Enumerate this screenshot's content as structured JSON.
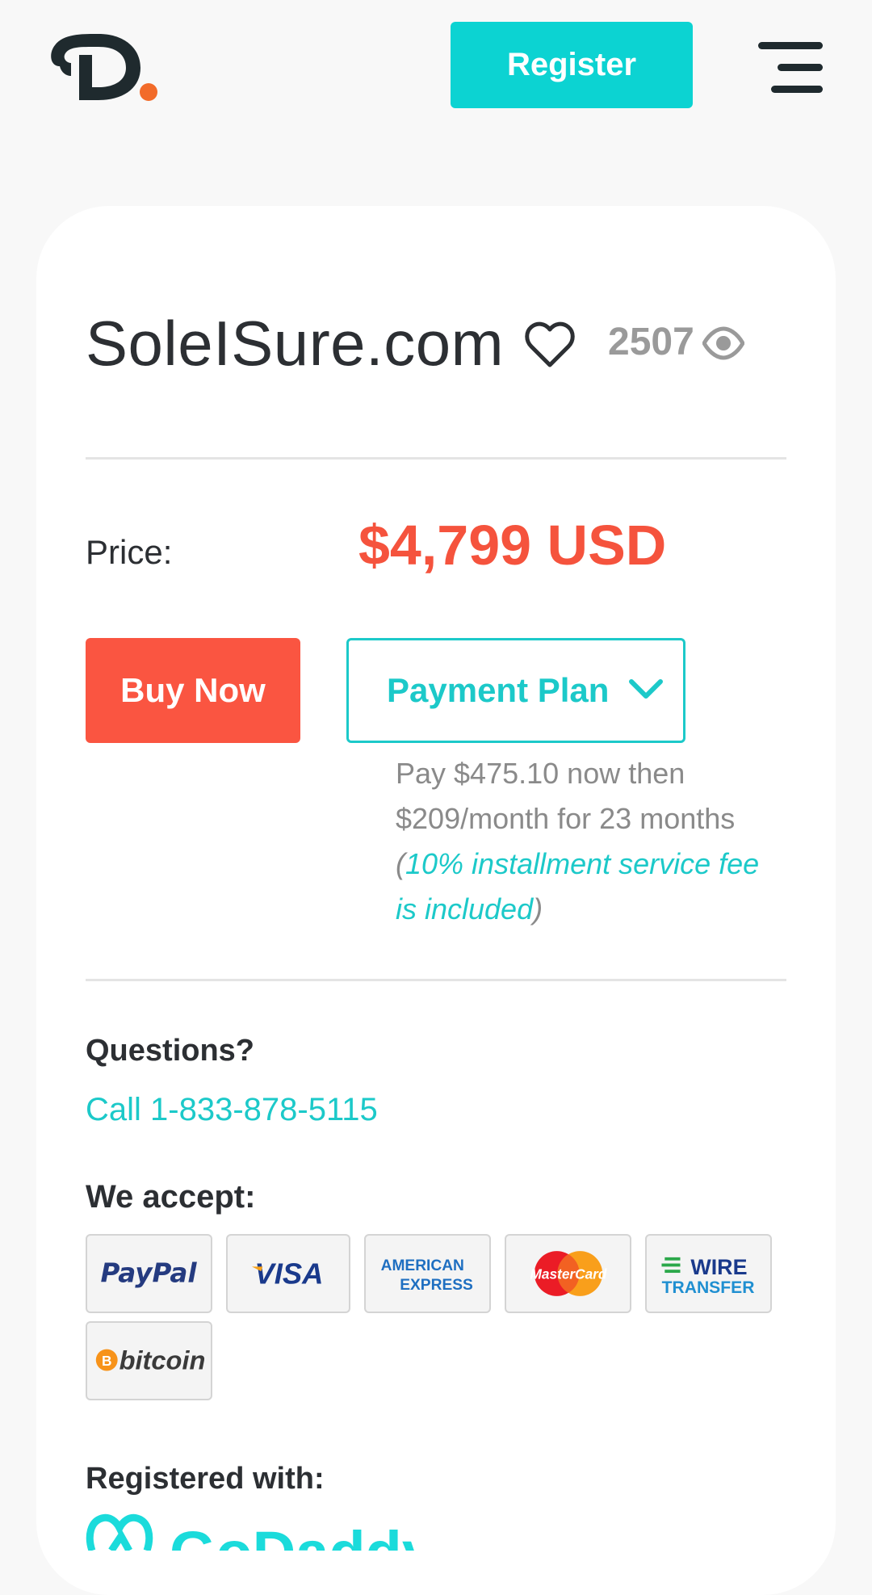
{
  "header": {
    "logo_letter": "D",
    "register_label": "Register",
    "menu_icon": "hamburger-menu-icon"
  },
  "listing": {
    "domain": "SoleISure.com",
    "favorite_icon": "heart-outline-icon",
    "views": "2507",
    "views_icon": "eye-icon"
  },
  "pricing": {
    "price_label": "Price:",
    "price_value": "$4,799 USD",
    "buy_label": "Buy Now",
    "plan_label": "Payment Plan",
    "plan_line1": "Pay $475.10 now then",
    "plan_line2": "$209/month for 23 months",
    "fee_open": "(",
    "fee_text": "10% installment service fee is included",
    "fee_close": ")"
  },
  "contact": {
    "questions_label": "Questions?",
    "call_label": "Call 1-833-878-5115"
  },
  "payments": {
    "accept_label": "We accept:",
    "methods": [
      {
        "name": "PayPal",
        "text": "PayPal"
      },
      {
        "name": "Visa",
        "text": "VISA"
      },
      {
        "name": "American Express",
        "line1": "AMERICAN",
        "line2": "EXPRESS"
      },
      {
        "name": "MasterCard",
        "text": "MasterCard"
      },
      {
        "name": "Wire Transfer",
        "line1": "WIRE",
        "line2": "TRANSFER"
      },
      {
        "name": "Bitcoin",
        "text": "bitcoin",
        "symbol": "B"
      }
    ]
  },
  "registrar": {
    "label": "Registered with:",
    "name": "GoDaddy"
  },
  "colors": {
    "accent_teal": "#0cd3d2",
    "price_red": "#f5533d",
    "buy_red": "#fa5541",
    "text_dark": "#2c2f33"
  }
}
